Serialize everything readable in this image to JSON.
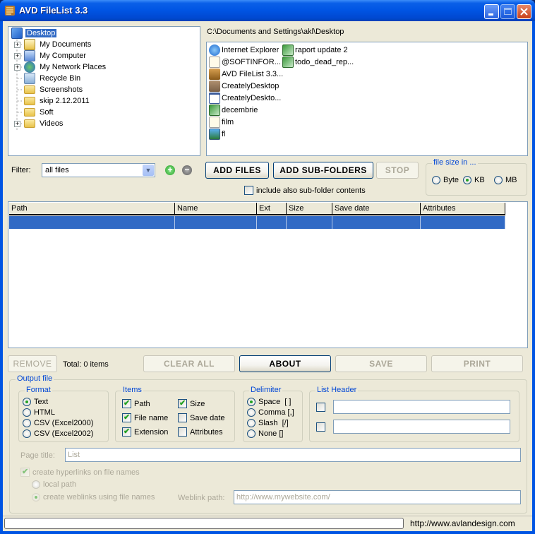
{
  "window": {
    "title": "AVD FileList 3.3",
    "controls": [
      "minimize",
      "maximize",
      "close"
    ]
  },
  "tree": {
    "items": [
      {
        "label": "Desktop",
        "icon": "desktop-icon",
        "selected": true,
        "expandable": false
      },
      {
        "label": "My Documents",
        "icon": "my-documents-icon",
        "expandable": true
      },
      {
        "label": "My Computer",
        "icon": "my-computer-icon",
        "expandable": true
      },
      {
        "label": "My Network Places",
        "icon": "network-places-icon",
        "expandable": true
      },
      {
        "label": "Recycle Bin",
        "icon": "recycle-bin-icon",
        "expandable": false
      },
      {
        "label": "Screenshots",
        "icon": "folder-icon",
        "expandable": false
      },
      {
        "label": "skip 2.12.2011",
        "icon": "folder-icon",
        "expandable": false
      },
      {
        "label": "Soft",
        "icon": "folder-icon",
        "expandable": false
      },
      {
        "label": "Videos",
        "icon": "folder-icon",
        "expandable": true
      }
    ]
  },
  "files": {
    "current_path": "C:\\Documents and Settings\\akl\\Desktop",
    "items": [
      {
        "label": "Internet Explorer",
        "icon": "internet-explorer-icon"
      },
      {
        "label": "@SOFTINFOR...",
        "icon": "image-file-icon"
      },
      {
        "label": "AVD FileList 3.3...",
        "icon": "avd-filelist-icon"
      },
      {
        "label": "CreatelyDesktop",
        "icon": "creately-icon"
      },
      {
        "label": "CreatelyDeskto...",
        "icon": "window-app-icon"
      },
      {
        "label": "decembrie",
        "icon": "excel-file-icon"
      },
      {
        "label": "film",
        "icon": "image-file-icon"
      },
      {
        "label": "fl",
        "icon": "installer-icon"
      },
      {
        "label": "raport update 2",
        "icon": "excel-file-icon"
      },
      {
        "label": "todo_dead_rep...",
        "icon": "excel-file-icon"
      }
    ]
  },
  "filter": {
    "label": "Filter:",
    "value": "all files",
    "add_icon": "plus-icon",
    "remove_icon": "minus-icon"
  },
  "actions": {
    "add_files": "ADD FILES",
    "add_subfolders": "ADD SUB-FOLDERS",
    "stop": "STOP",
    "include_subfolders_label": "include also sub-folder contents",
    "include_subfolders_checked": false
  },
  "file_size": {
    "legend": "file size in ...",
    "options": [
      "Byte",
      "KB",
      "MB"
    ],
    "selected": "KB"
  },
  "list": {
    "columns": [
      "Path",
      "Name",
      "Ext",
      "Size",
      "Save date",
      "Attributes"
    ],
    "rows": []
  },
  "bottom_actions": {
    "remove": "REMOVE",
    "total": "Total: 0 items",
    "clear_all": "CLEAR ALL",
    "about": "ABOUT",
    "save": "SAVE",
    "print": "PRINT"
  },
  "output": {
    "legend": "Output file",
    "format": {
      "legend": "Format",
      "options": [
        "Text",
        "HTML",
        "CSV (Excel2000)",
        "CSV (Excel2002)"
      ],
      "selected": "Text"
    },
    "items": {
      "legend": "Items",
      "options": [
        {
          "label": "Path",
          "checked": true
        },
        {
          "label": "File name",
          "checked": true
        },
        {
          "label": "Extension",
          "checked": true
        },
        {
          "label": "Size",
          "checked": true
        },
        {
          "label": "Save date",
          "checked": false
        },
        {
          "label": "Attributes",
          "checked": false
        }
      ]
    },
    "delimiter": {
      "legend": "Delimiter",
      "options": [
        "Space  [ ]",
        "Comma [,]",
        "Slash  [/]",
        "None []"
      ],
      "selected": "Space  [ ]"
    },
    "list_header": {
      "legend": "List Header",
      "line1": "",
      "line2": ""
    },
    "page_title_label": "Page title:",
    "page_title_value": "List",
    "hyperlinks_label": "create hyperlinks on file names",
    "hyperlinks_checked": true,
    "local_path_label": "local path",
    "weblinks_label": "create weblinks using file names",
    "link_mode_selected": "weblinks",
    "weblink_path_label": "Weblink path:",
    "weblink_path_value": "http://www.mywebsite.com/"
  },
  "status": {
    "progress": 0,
    "website": "http://www.avlandesign.com"
  }
}
